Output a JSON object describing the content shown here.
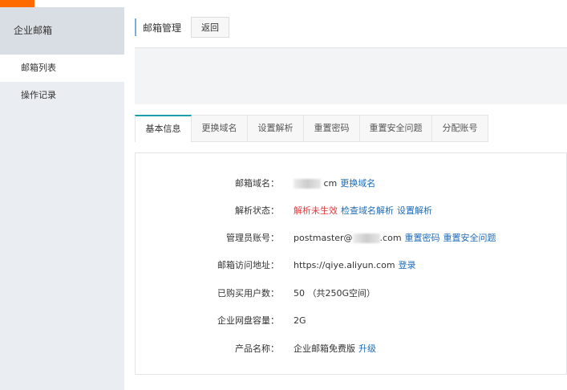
{
  "sidebar": {
    "title": "企业邮箱",
    "items": [
      {
        "label": "邮箱列表"
      },
      {
        "label": "操作记录"
      }
    ]
  },
  "header": {
    "title": "邮箱管理",
    "back_label": "返回"
  },
  "tabs": [
    {
      "label": "基本信息"
    },
    {
      "label": "更换域名"
    },
    {
      "label": "设置解析"
    },
    {
      "label": "重置密码"
    },
    {
      "label": "重置安全问题"
    },
    {
      "label": "分配账号"
    }
  ],
  "info": {
    "domain": {
      "label": "邮箱域名：",
      "value": "cm",
      "link": "更换域名"
    },
    "dns": {
      "label": "解析状态：",
      "status": "解析未生效",
      "link1": "检查域名解析",
      "link2": "设置解析"
    },
    "admin": {
      "label": "管理员账号：",
      "prefix": "postmaster@",
      "suffix": ".com",
      "link1": "重置密码",
      "link2": "重置安全问题"
    },
    "url": {
      "label": "邮箱访问地址：",
      "value": "https://qiye.aliyun.com",
      "link": "登录"
    },
    "users": {
      "label": "已购买用户数：",
      "value": "50 （共250G空间）"
    },
    "disk": {
      "label": "企业网盘容量：",
      "value": "2G"
    },
    "product": {
      "label": "产品名称：",
      "value": "企业邮箱免费版",
      "link": "升级"
    }
  },
  "colors": {
    "accent": "#ff6a00",
    "link": "#1e6bb8",
    "error": "#e4393c",
    "tab_active": "#1ba0a8"
  }
}
